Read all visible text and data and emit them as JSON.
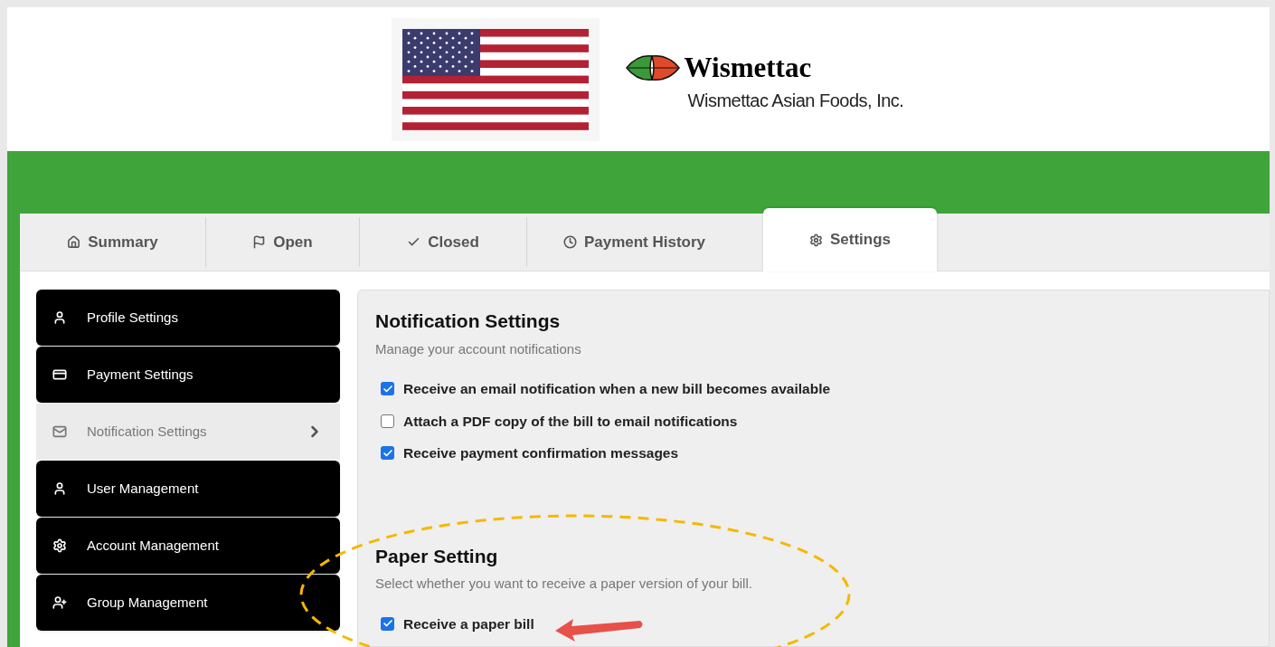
{
  "header": {
    "brand": "Wismettac",
    "company": "Wismettac Asian Foods, Inc."
  },
  "tabs": [
    {
      "label": "Summary",
      "kind": "home",
      "selected": false
    },
    {
      "label": "Open",
      "kind": "flag",
      "selected": false
    },
    {
      "label": "Closed",
      "kind": "check",
      "selected": false
    },
    {
      "label": "Payment History",
      "kind": "clock",
      "selected": false
    },
    {
      "label": "Settings",
      "kind": "gear",
      "selected": true
    }
  ],
  "sidebar": {
    "items": [
      {
        "label": "Profile Settings",
        "kind": "user",
        "selected": false
      },
      {
        "label": "Payment Settings",
        "kind": "card",
        "selected": false
      },
      {
        "label": "Notification Settings",
        "kind": "mail",
        "selected": true
      },
      {
        "label": "User Management",
        "kind": "user",
        "selected": false
      },
      {
        "label": "Account Management",
        "kind": "gear",
        "selected": false
      },
      {
        "label": "Group Management",
        "kind": "group",
        "selected": false
      }
    ]
  },
  "sections": [
    {
      "title": "Notification Settings",
      "subtitle": "Manage your account notifications",
      "options": [
        {
          "label": "Receive an email notification when a new bill becomes available",
          "checked": true
        },
        {
          "label": "Attach a PDF copy of the bill to email notifications",
          "checked": false
        },
        {
          "label": "Receive payment confirmation messages",
          "checked": true
        }
      ]
    },
    {
      "title": "Paper Setting",
      "subtitle": "Select whether you want to receive a paper version of your bill.",
      "options": [
        {
          "label": "Receive a paper bill",
          "checked": true
        }
      ]
    }
  ]
}
